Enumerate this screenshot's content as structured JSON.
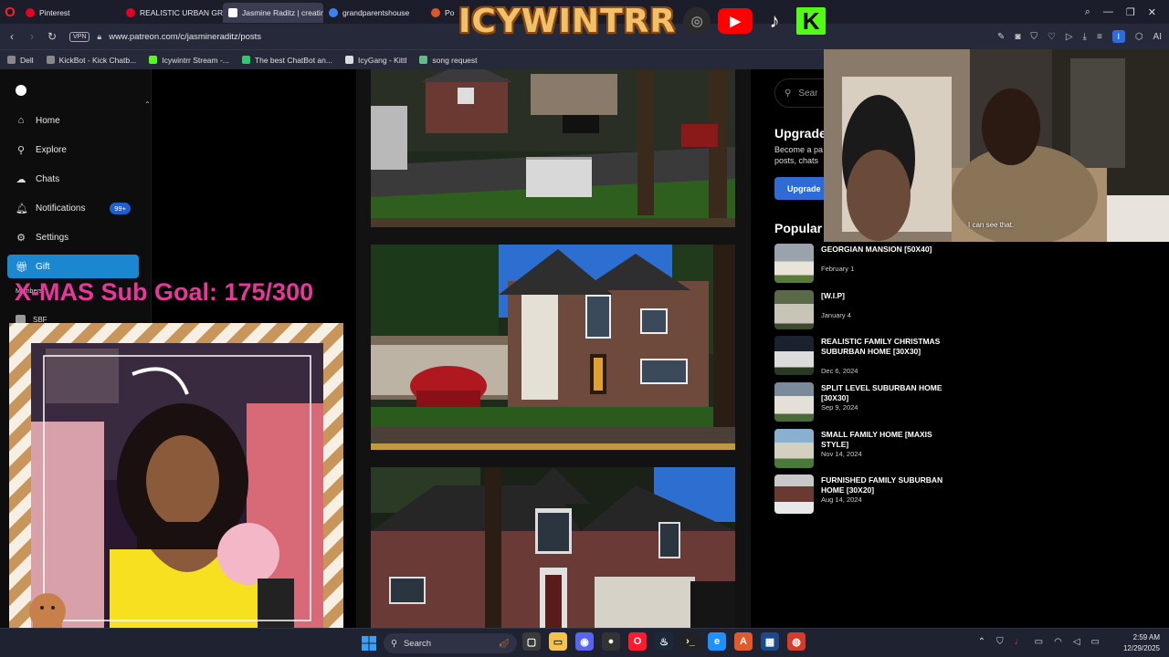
{
  "browser": {
    "tabs": [
      {
        "label": "Pinterest",
        "color": "#e60023"
      },
      {
        "label": "REALISTIC URBAN GRAND",
        "color": "#e60023"
      },
      {
        "label": "Jasmine Raditz | creating",
        "color": "#ffffff",
        "active": true
      },
      {
        "label": "grandparentshouse",
        "color": "#3b82f6"
      },
      {
        "label": "Po",
        "color": "#e0562b"
      }
    ],
    "url": "www.patreon.com/c/jasmineraditz/posts",
    "vpn_label": "VPN",
    "bookmarks": [
      "Dell",
      "KickBot - Kick Chatb...",
      "Icywintrr Stream -...",
      "The best ChatBot an...",
      "IcyGang - Kittl",
      "song request"
    ]
  },
  "stream_overlay": {
    "brand": "ICYWINTRR",
    "sub_goal": "X-MAS Sub Goal: 175/300",
    "caption": "I can see that."
  },
  "sidebar": {
    "items": [
      {
        "label": "Home",
        "icon": "home-icon"
      },
      {
        "label": "Explore",
        "icon": "search-icon"
      },
      {
        "label": "Chats",
        "icon": "chat-icon"
      },
      {
        "label": "Notifications",
        "icon": "bell-icon",
        "badge": "99+"
      },
      {
        "label": "Settings",
        "icon": "gear-icon"
      },
      {
        "label": "Gift",
        "icon": "gift-icon"
      }
    ],
    "peek_label": "Members",
    "peek_item": "SBF"
  },
  "right_panel": {
    "search_placeholder": "Sear",
    "upgrade_title": "Upgrade",
    "upgrade_text_1": "Become a pa",
    "upgrade_text_2": "posts, chats",
    "upgrade_button": "Upgrade",
    "popular_title": "Popular"
  },
  "popular_posts": [
    {
      "title": "GEORGIAN MANSION [50X40]",
      "date": "February 1"
    },
    {
      "title": "[W.I.P]",
      "date": "January 4"
    },
    {
      "title": "REALISTIC FAMILY CHRISTMAS SUBURBAN HOME [30X30]",
      "date": "Dec 6, 2024"
    },
    {
      "title": "SPLIT LEVEL SUBURBAN HOME [30X30]",
      "date": "Sep 9, 2024"
    },
    {
      "title": "SMALL FAMILY HOME [MAXIS STYLE]",
      "date": "Nov 14, 2024"
    },
    {
      "title": "FURNISHED FAMILY SUBURBAN HOME [30X20]",
      "date": "Aug 14, 2024"
    }
  ],
  "taskbar": {
    "search_label": "Search",
    "time": "2:59 AM",
    "date": "12/29/2025"
  }
}
